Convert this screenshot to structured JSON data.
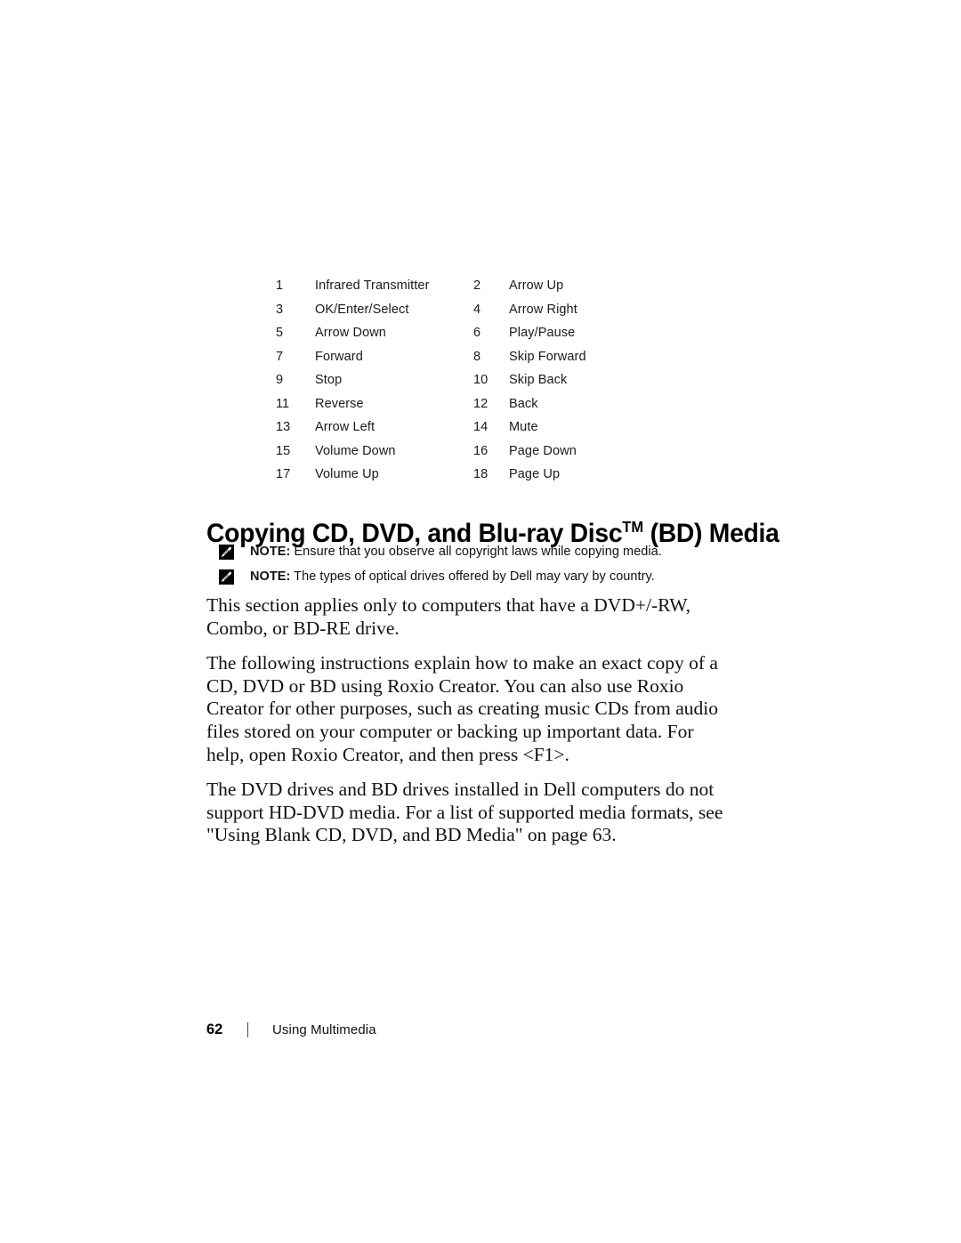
{
  "document": {
    "page_number": "62",
    "footer_section_title": "Using Multimedia",
    "footer_divider": "|"
  },
  "legend": {
    "rows": [
      {
        "num_left": "1",
        "label_left": "Infrared Transmitter",
        "num_right": "2",
        "label_right": "Arrow Up"
      },
      {
        "num_left": "3",
        "label_left": "OK/Enter/Select",
        "num_right": "4",
        "label_right": "Arrow Right"
      },
      {
        "num_left": "5",
        "label_left": "Arrow Down",
        "num_right": "6",
        "label_right": "Play/Pause"
      },
      {
        "num_left": "7",
        "label_left": "Forward",
        "num_right": "8",
        "label_right": "Skip Forward"
      },
      {
        "num_left": "9",
        "label_left": "Stop",
        "num_right": "10",
        "label_right": "Skip Back"
      },
      {
        "num_left": "11",
        "label_left": "Reverse",
        "num_right": "12",
        "label_right": "Back"
      },
      {
        "num_left": "13",
        "label_left": "Arrow Left",
        "num_right": "14",
        "label_right": "Mute"
      },
      {
        "num_left": "15",
        "label_left": "Volume Down",
        "num_right": "16",
        "label_right": "Page Down"
      },
      {
        "num_left": "17",
        "label_left": "Volume Up",
        "num_right": "18",
        "label_right": "Page Up"
      }
    ]
  },
  "section": {
    "heading_before_tm": "Copying CD, DVD, and Blu-ray Disc",
    "heading_tm": "TM",
    "heading_after_tm": " (BD) Media"
  },
  "notes": [
    {
      "icon": "note-pencil-icon",
      "label": "NOTE:",
      "text": " Ensure that you observe all copyright laws while copying media."
    },
    {
      "icon": "note-pencil-icon",
      "label": "NOTE:",
      "text": " The types of optical drives offered by Dell may vary by country."
    }
  ],
  "body": {
    "paragraph_1": "This section applies only to computers that have a DVD+/-RW, Combo, or BD-RE drive.",
    "paragraph_2": "The following instructions explain how to make an exact copy of a CD, DVD or BD using Roxio Creator. You can also use Roxio Creator for other purposes, such as creating music CDs from audio files stored on your computer or backing up important data. For help, open Roxio Creator, and then press <F1>.",
    "paragraph_3": "The DVD drives and BD drives installed in Dell computers do not support HD-DVD media. For a list of supported media formats, see \"Using Blank CD, DVD, and BD Media\" on page 63."
  },
  "colors": {
    "text": "#111111",
    "heading": "#000000",
    "page_background": "#ffffff",
    "note_icon_background": "#000000"
  }
}
